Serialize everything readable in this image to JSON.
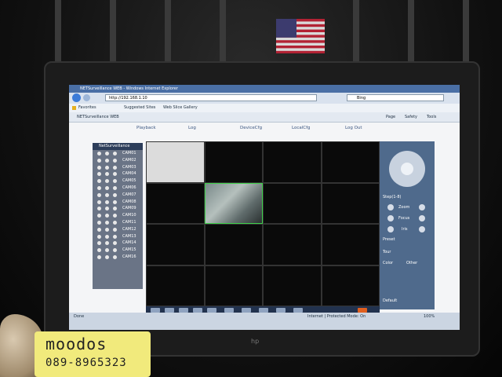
{
  "browser": {
    "title": "NETSurveillance WEB - Windows Internet Explorer",
    "url": "http://192.168.1.10",
    "search_placeholder": "Bing",
    "favorites_label": "Favorites",
    "suggested_sites": "Suggested Sites",
    "web_slice": "Web Slice Gallery",
    "tab_title": "NETSurveillance WEB",
    "page_menu": "Page",
    "safety_menu": "Safety",
    "tools_menu": "Tools",
    "status_left": "Done",
    "status_zone": "Internet | Protected Mode: On",
    "zoom": "100%"
  },
  "app": {
    "menu": [
      "Playback",
      "Log",
      "DeviceCfg",
      "LocalCfg",
      "Log Out"
    ],
    "sidebar_title": "NetSurveillance",
    "cameras": [
      "CAM01",
      "CAM02",
      "CAM03",
      "CAM04",
      "CAM05",
      "CAM06",
      "CAM07",
      "CAM08",
      "CAM09",
      "CAM10",
      "CAM11",
      "CAM12",
      "CAM13",
      "CAM14",
      "CAM15",
      "CAM16"
    ],
    "ptz": {
      "step_label": "Step(1-8)",
      "zoom": "Zoom",
      "focus": "Focus",
      "iris": "Iris",
      "preset": "Preset",
      "tour": "Tour",
      "color": "Color",
      "other": "Other",
      "default": "Default"
    }
  },
  "note": {
    "line1": "moodos",
    "line2": "089-8965323"
  },
  "monitor": {
    "brand": "hp"
  }
}
